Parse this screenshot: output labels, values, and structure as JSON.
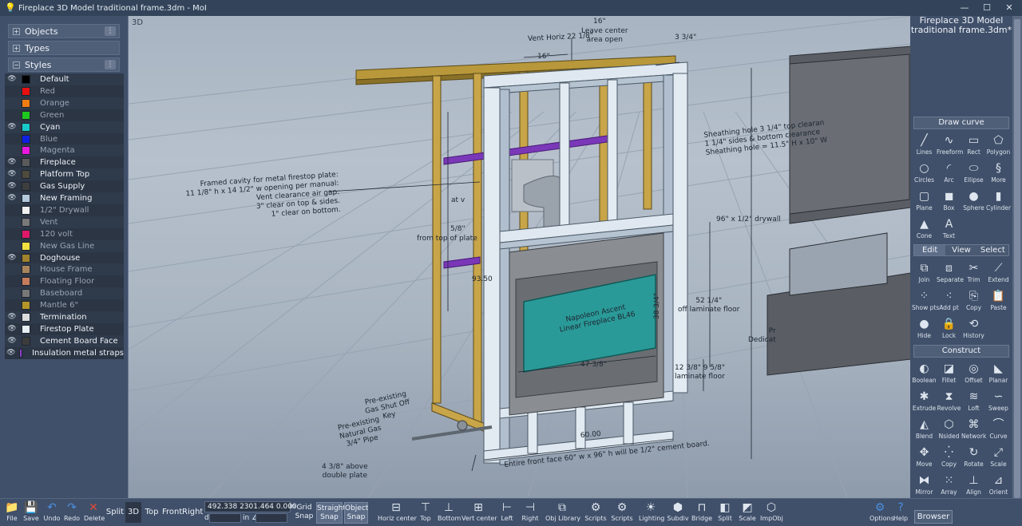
{
  "window": {
    "title": "Fireplace 3D Model traditional frame.3dm - MoI",
    "controls": [
      "—",
      "☐",
      "✕"
    ]
  },
  "left_panel": {
    "sections": [
      {
        "label": "Objects",
        "toggle": "+"
      },
      {
        "label": "Types",
        "toggle": "+"
      },
      {
        "label": "Styles",
        "toggle": "−"
      }
    ],
    "menu_glyph": "⋮",
    "styles": [
      {
        "name": "Default",
        "color": "#000000",
        "visible": true
      },
      {
        "name": "Red",
        "color": "#e81010",
        "visible": false
      },
      {
        "name": "Orange",
        "color": "#f07d12",
        "visible": false
      },
      {
        "name": "Green",
        "color": "#1ec81e",
        "visible": false
      },
      {
        "name": "Cyan",
        "color": "#19c8c8",
        "visible": true
      },
      {
        "name": "Blue",
        "color": "#1020e0",
        "visible": false
      },
      {
        "name": "Magenta",
        "color": "#e818e0",
        "visible": false
      },
      {
        "name": "Fireplace",
        "color": "#5a5a5a",
        "visible": true
      },
      {
        "name": "Platform Top",
        "color": "#4e4a3c",
        "visible": true
      },
      {
        "name": "Gas Supply",
        "color": "#3e3e3e",
        "visible": true
      },
      {
        "name": "New Framing",
        "color": "#b4c8dc",
        "visible": true
      },
      {
        "name": "1/2\" Drywall",
        "color": "#f0f0f0",
        "visible": false
      },
      {
        "name": "Vent",
        "color": "#787878",
        "visible": false
      },
      {
        "name": "120 volt",
        "color": "#e0186a",
        "visible": false
      },
      {
        "name": "New Gas Line",
        "color": "#f0e040",
        "visible": false
      },
      {
        "name": "Doghouse",
        "color": "#a0822c",
        "visible": true
      },
      {
        "name": "House Frame",
        "color": "#a8845c",
        "visible": false
      },
      {
        "name": "Floating Floor",
        "color": "#c47c5c",
        "visible": false
      },
      {
        "name": "Baseboard",
        "color": "#787878",
        "visible": false
      },
      {
        "name": "Mantle 6\"",
        "color": "#b49628",
        "visible": false
      },
      {
        "name": "Termination",
        "color": "#dcdcdc",
        "visible": true
      },
      {
        "name": "Firestop Plate",
        "color": "#e6f0f4",
        "visible": true
      },
      {
        "name": "Cement Board Face",
        "color": "#3c3c3c",
        "visible": true
      },
      {
        "name": "Insulation metal straps",
        "color": "#8c3cc8",
        "visible": true
      }
    ],
    "eye_glyph": "👁"
  },
  "viewport": {
    "label": "3D",
    "annotations": {
      "top_16": "16\"",
      "leave_center": "Leave center\narea open",
      "vent_horiz": "Vent Horiz 22 1/8\"",
      "top_16b": "16\"",
      "dim_3_3_4": "3 3/4\"",
      "sheathing": "Sheathing hole 3 1/4\" top clearan\n1 1/4\" sides & bottom clearance\nSheathing hole = 11.5\" H x 10\" W",
      "framed_cavity": "Framed cavity for metal firestop plate:\n11 1/8\" h x 14 1/2\" w opening per manual:\nVent clearance air gap:\n3\" clear on top & sides.\n1\" clear on bottom.",
      "drywall": "96\" x 1/2\" drywall",
      "at_v": "at v",
      "five_eighths": "5/8\"",
      "from_plate": "from top of plate",
      "dim_93_50": "93.50",
      "laminate_52": "52 1/4\"\noff laminate floor",
      "napoleon": "Napoleon Ascent\nLinear Fireplace BL46",
      "dim_38_3_4": "38 3/4\"",
      "dim_47_3_8": "47 3/8\"",
      "laminate_12": "12 3/8\" 9 5/8\"\nlaminate floor",
      "gas_shutoff": "Pre-existing\nGas Shut Off\nKey",
      "natural_gas": "Pre-existing\nNatural Gas\n3/4\" Pipe",
      "above_plate": "4 3/8\" above\ndouble plate",
      "dim_60": "60.00",
      "front_face": "Entire front face 60\" w x 96\" h will be 1/2\" cement board.",
      "dedicat": "Pr\nDedicat"
    }
  },
  "right_panel": {
    "doc_title": "Fireplace 3D Model traditional frame.3dm*",
    "draw_curve_label": "Draw curve",
    "draw_tools": [
      {
        "label": "Lines",
        "icon": "line-icon",
        "glyph": "╱"
      },
      {
        "label": "Freeform",
        "icon": "freeform-icon",
        "glyph": "∿"
      },
      {
        "label": "Rect",
        "icon": "rect-icon",
        "glyph": "▭"
      },
      {
        "label": "Polygon",
        "icon": "polygon-icon",
        "glyph": "⬠"
      },
      {
        "label": "Circles",
        "icon": "circle-icon",
        "glyph": "○"
      },
      {
        "label": "Arc",
        "icon": "arc-icon",
        "glyph": "◜"
      },
      {
        "label": "Ellipse",
        "icon": "ellipse-icon",
        "glyph": "⬭"
      },
      {
        "label": "More",
        "icon": "more-icon",
        "glyph": "§"
      },
      {
        "label": "Plane",
        "icon": "plane-icon",
        "glyph": "▢"
      },
      {
        "label": "Box",
        "icon": "box-icon",
        "glyph": "◼"
      },
      {
        "label": "Sphere",
        "icon": "sphere-icon",
        "glyph": "●"
      },
      {
        "label": "Cylinder",
        "icon": "cylinder-icon",
        "glyph": "▮"
      },
      {
        "label": "Cone",
        "icon": "cone-icon",
        "glyph": "▲"
      },
      {
        "label": "Text",
        "icon": "text-icon",
        "glyph": "A"
      }
    ],
    "tabs": [
      {
        "label": "Edit",
        "active": true
      },
      {
        "label": "View",
        "active": false
      },
      {
        "label": "Select",
        "active": false
      }
    ],
    "edit_tools": [
      {
        "label": "Join",
        "icon": "join-icon",
        "glyph": "⧉"
      },
      {
        "label": "Separate",
        "icon": "separate-icon",
        "glyph": "⧈"
      },
      {
        "label": "Trim",
        "icon": "trim-icon",
        "glyph": "✂"
      },
      {
        "label": "Extend",
        "icon": "extend-icon",
        "glyph": "⟋"
      },
      {
        "label": "Show pts",
        "icon": "show-points-icon",
        "glyph": "⁘"
      },
      {
        "label": "Add pt",
        "icon": "add-point-icon",
        "glyph": "⁖"
      },
      {
        "label": "Copy",
        "icon": "copy-icon",
        "glyph": "⎘"
      },
      {
        "label": "Paste",
        "icon": "paste-icon",
        "glyph": "📋"
      },
      {
        "label": "Hide",
        "icon": "hide-icon",
        "glyph": "●"
      },
      {
        "label": "Lock",
        "icon": "lock-icon",
        "glyph": "🔒"
      },
      {
        "label": "History",
        "icon": "history-icon",
        "glyph": "⟲"
      }
    ],
    "construct_label": "Construct",
    "construct_tools": [
      {
        "label": "Boolean",
        "icon": "boolean-icon",
        "glyph": "◐"
      },
      {
        "label": "Fillet",
        "icon": "fillet-icon",
        "glyph": "◪"
      },
      {
        "label": "Offset",
        "icon": "offset-icon",
        "glyph": "◎"
      },
      {
        "label": "Planar",
        "icon": "planar-icon",
        "glyph": "◣"
      },
      {
        "label": "Extrude",
        "icon": "extrude-icon",
        "glyph": "✱"
      },
      {
        "label": "Revolve",
        "icon": "revolve-icon",
        "glyph": "⧗"
      },
      {
        "label": "Loft",
        "icon": "loft-icon",
        "glyph": "≋"
      },
      {
        "label": "Sweep",
        "icon": "sweep-icon",
        "glyph": "∽"
      },
      {
        "label": "Blend",
        "icon": "blend-icon",
        "glyph": "◭"
      },
      {
        "label": "Nsided",
        "icon": "nsided-icon",
        "glyph": "⬡"
      },
      {
        "label": "Network",
        "icon": "network-icon",
        "glyph": "⌘"
      },
      {
        "label": "Curve",
        "icon": "curve-icon",
        "glyph": "⌒"
      },
      {
        "label": "Move",
        "icon": "move-icon",
        "glyph": "✥"
      },
      {
        "label": "Copy",
        "icon": "copy-transform-icon",
        "glyph": "⁛"
      },
      {
        "label": "Rotate",
        "icon": "rotate-icon",
        "glyph": "↻"
      },
      {
        "label": "Scale",
        "icon": "scale-icon",
        "glyph": "⤢"
      },
      {
        "label": "Mirror",
        "icon": "mirror-icon",
        "glyph": "⧓"
      },
      {
        "label": "Array",
        "icon": "array-icon",
        "glyph": "⁙"
      },
      {
        "label": "Align",
        "icon": "align-icon",
        "glyph": "⊥"
      },
      {
        "label": "Orient",
        "icon": "orient-icon",
        "glyph": "⊿"
      }
    ]
  },
  "bottom_bar": {
    "file_buttons": [
      {
        "label": "File",
        "icon": "folder-icon",
        "glyph": "📁",
        "tone": ""
      },
      {
        "label": "Save",
        "icon": "save-icon",
        "glyph": "💾",
        "tone": ""
      },
      {
        "label": "Undo",
        "icon": "undo-icon",
        "glyph": "↶",
        "tone": "blue"
      },
      {
        "label": "Redo",
        "icon": "redo-icon",
        "glyph": "↷",
        "tone": "blue"
      },
      {
        "label": "Delete",
        "icon": "delete-icon",
        "glyph": "✕",
        "tone": "red"
      }
    ],
    "view_buttons": [
      {
        "label": "Split",
        "active": false
      },
      {
        "label": "3D",
        "active": true
      },
      {
        "label": "Top",
        "active": false
      },
      {
        "label": "Front",
        "active": false
      },
      {
        "label": "Right",
        "active": false
      }
    ],
    "coords": "492.338  2301.464  0.000",
    "coord_unit": "in",
    "d_label": "d",
    "in_label": "in ∠",
    "snaps": [
      {
        "label": "Grid\nSnap",
        "on": false
      },
      {
        "label": "Straight\nSnap",
        "on": true
      },
      {
        "label": "Object\nSnap",
        "on": true
      }
    ],
    "scripts": [
      {
        "label": "Horiz center",
        "icon": "horiz-center-icon",
        "glyph": "⊟"
      },
      {
        "label": "Top",
        "icon": "align-top-icon",
        "glyph": "⊤"
      },
      {
        "label": "Bottom",
        "icon": "align-bottom-icon",
        "glyph": "⊥"
      },
      {
        "label": "Vert center",
        "icon": "vert-center-icon",
        "glyph": "⊞"
      },
      {
        "label": "Left",
        "icon": "align-left-icon",
        "glyph": "⊢"
      },
      {
        "label": "Right",
        "icon": "align-right-icon",
        "glyph": "⊣"
      },
      {
        "label": "Obj Library",
        "icon": "library-icon",
        "glyph": "⧉"
      },
      {
        "label": "Scripts",
        "icon": "scripts-icon",
        "glyph": "⚙"
      },
      {
        "label": "Scripts",
        "icon": "scripts2-icon",
        "glyph": "⚙"
      },
      {
        "label": "Lighting",
        "icon": "lighting-icon",
        "glyph": "☀"
      },
      {
        "label": "Subdiv",
        "icon": "subdiv-icon",
        "glyph": "⬢"
      },
      {
        "label": "Bridge",
        "icon": "bridge-icon",
        "glyph": "⊓"
      },
      {
        "label": "Split",
        "icon": "split-icon",
        "glyph": "◧"
      },
      {
        "label": "Scale",
        "icon": "scale-script-icon",
        "glyph": "◩"
      },
      {
        "label": "ImpObj",
        "icon": "import-object-icon",
        "glyph": "⬡"
      }
    ],
    "options_label": "Options",
    "help_label": "Help",
    "browser_label": "Browser"
  }
}
